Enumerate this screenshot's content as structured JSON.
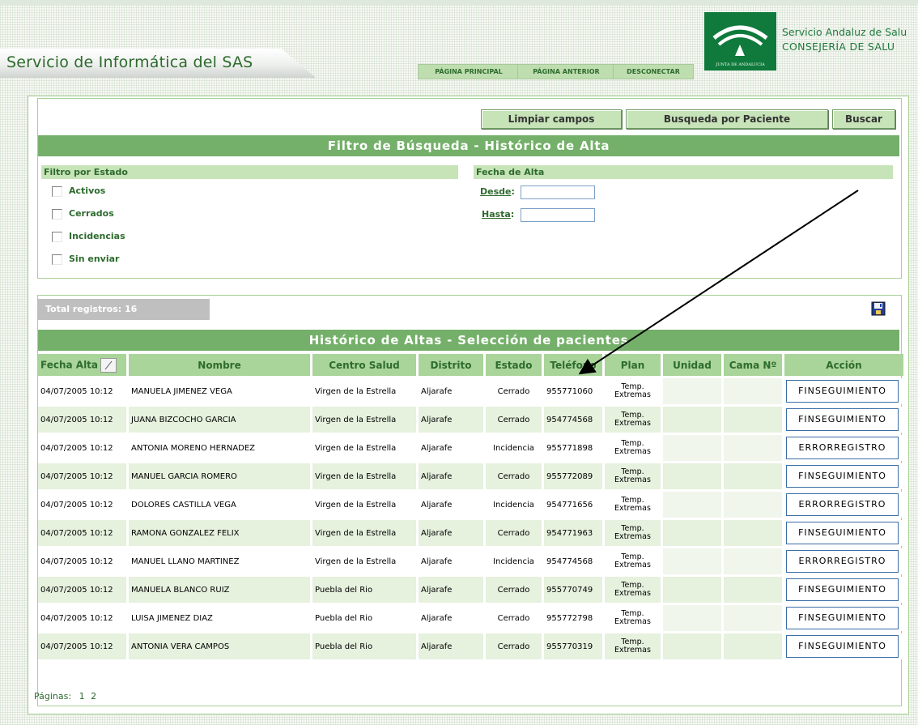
{
  "header": {
    "app_title": "Servicio de Informática del SAS",
    "nav": {
      "home": "PÁGINA PRINCIPAL",
      "back": "PÁGINA ANTERIOR",
      "logout": "DESCONECTAR"
    },
    "logo_caption": "JUNTA DE ANDALUCIA",
    "org_line1": "Servicio Andaluz de Salu",
    "org_line2": "CONSEJERÍA DE SALU"
  },
  "filter": {
    "buttons": {
      "clear": "Limpiar campos",
      "search_patient": "Busqueda por Paciente",
      "search": "Buscar"
    },
    "title": "Filtro de Búsqueda - Histórico de Alta",
    "estado_header": "Filtro por Estado",
    "estado_options": [
      "Activos",
      "Cerrados",
      "Incidencias",
      "Sin enviar"
    ],
    "fecha_header": "Fecha de Alta",
    "desde_label": "Desde",
    "hasta_label": "Hasta",
    "desde_value": "",
    "hasta_value": ""
  },
  "results": {
    "total": "Total registros: 16",
    "title": "Histórico de Altas - Selección de pacientes",
    "columns": [
      "Fecha Alta",
      "Nombre",
      "Centro Salud",
      "Distrito",
      "Estado",
      "Teléfono",
      "Plan",
      "Unidad",
      "Cama Nº",
      "Acción"
    ],
    "rows": [
      {
        "fecha": "04/07/2005 10:12",
        "nombre": "MANUELA JIMENEZ VEGA",
        "centro": "Virgen de la Estrella",
        "distrito": "Aljarafe",
        "estado": "Cerrado",
        "telefono": "955771060",
        "plan1": "Temp.",
        "plan2": "Extremas",
        "unidad": "",
        "cama": "",
        "accion": "FINSEGUIMIENTO"
      },
      {
        "fecha": "04/07/2005 10:12",
        "nombre": "JUANA BIZCOCHO GARCIA",
        "centro": "Virgen de la Estrella",
        "distrito": "Aljarafe",
        "estado": "Cerrado",
        "telefono": "954774568",
        "plan1": "Temp.",
        "plan2": "Extremas",
        "unidad": "",
        "cama": "",
        "accion": "FINSEGUIMIENTO"
      },
      {
        "fecha": "04/07/2005 10:12",
        "nombre": "ANTONIA MORENO HERNADEZ",
        "centro": "Virgen de la Estrella",
        "distrito": "Aljarafe",
        "estado": "Incidencia",
        "telefono": "955771898",
        "plan1": "Temp.",
        "plan2": "Extremas",
        "unidad": "",
        "cama": "",
        "accion": "ERRORREGISTRO"
      },
      {
        "fecha": "04/07/2005 10:12",
        "nombre": "MANUEL GARCIA ROMERO",
        "centro": "Virgen de la Estrella",
        "distrito": "Aljarafe",
        "estado": "Cerrado",
        "telefono": "955772089",
        "plan1": "Temp.",
        "plan2": "Extremas",
        "unidad": "",
        "cama": "",
        "accion": "FINSEGUIMIENTO"
      },
      {
        "fecha": "04/07/2005 10:12",
        "nombre": "DOLORES CASTILLA VEGA",
        "centro": "Virgen de la Estrella",
        "distrito": "Aljarafe",
        "estado": "Incidencia",
        "telefono": "954771656",
        "plan1": "Temp.",
        "plan2": "Extremas",
        "unidad": "",
        "cama": "",
        "accion": "ERRORREGISTRO"
      },
      {
        "fecha": "04/07/2005 10:12",
        "nombre": "RAMONA GONZALEZ FELIX",
        "centro": "Virgen de la Estrella",
        "distrito": "Aljarafe",
        "estado": "Cerrado",
        "telefono": "954771963",
        "plan1": "Temp.",
        "plan2": "Extremas",
        "unidad": "",
        "cama": "",
        "accion": "FINSEGUIMIENTO"
      },
      {
        "fecha": "04/07/2005 10:12",
        "nombre": "MANUEL LLANO MARTINEZ",
        "centro": "Virgen de la Estrella",
        "distrito": "Aljarafe",
        "estado": "Incidencia",
        "telefono": "954774568",
        "plan1": "Temp.",
        "plan2": "Extremas",
        "unidad": "",
        "cama": "",
        "accion": "ERRORREGISTRO"
      },
      {
        "fecha": "04/07/2005 10:12",
        "nombre": "MANUELA BLANCO RUIZ",
        "centro": "Puebla del Rio",
        "distrito": "Aljarafe",
        "estado": "Cerrado",
        "telefono": "955770749",
        "plan1": "Temp.",
        "plan2": "Extremas",
        "unidad": "",
        "cama": "",
        "accion": "FINSEGUIMIENTO"
      },
      {
        "fecha": "04/07/2005 10:12",
        "nombre": "LUISA JIMENEZ DIAZ",
        "centro": "Puebla del Rio",
        "distrito": "Aljarafe",
        "estado": "Cerrado",
        "telefono": "955772798",
        "plan1": "Temp.",
        "plan2": "Extremas",
        "unidad": "",
        "cama": "",
        "accion": "FINSEGUIMIENTO"
      },
      {
        "fecha": "04/07/2005 10:12",
        "nombre": "ANTONIA VERA CAMPOS",
        "centro": "Puebla del Rio",
        "distrito": "Aljarafe",
        "estado": "Cerrado",
        "telefono": "955770319",
        "plan1": "Temp.",
        "plan2": "Extremas",
        "unidad": "",
        "cama": "",
        "accion": "FINSEGUIMIENTO"
      }
    ],
    "pagination": {
      "label": "Páginas:",
      "current": "1",
      "next": "2"
    }
  },
  "icons": {
    "save": "floppy-disk-icon",
    "sort": "sort-toggle-icon",
    "logo": "junta-andalucia-logo"
  },
  "colors": {
    "brand_green": "#74b069",
    "header_green": "#a9d49a",
    "light_green": "#c7e3b8",
    "row_alt": "#e6f1de",
    "title_text": "#2d6a2d"
  }
}
